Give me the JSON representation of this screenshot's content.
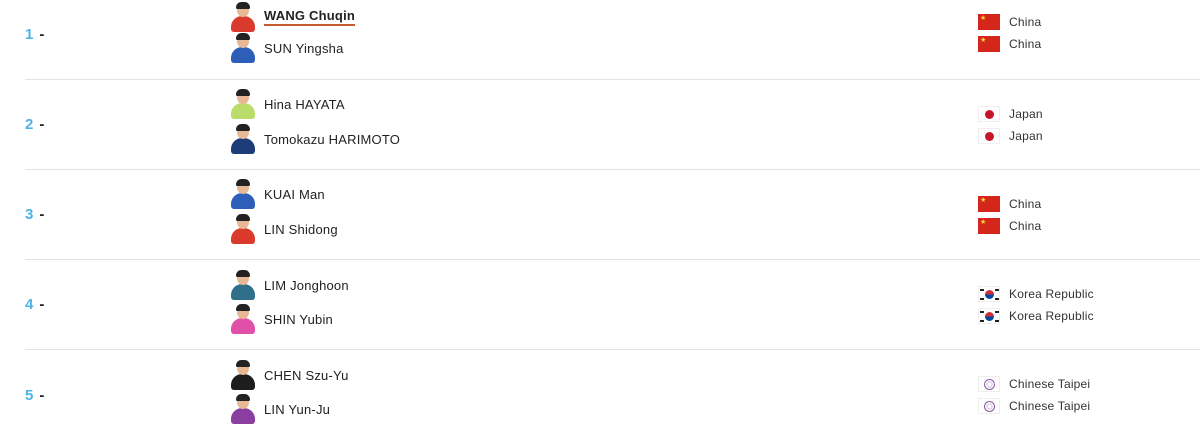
{
  "rankings": [
    {
      "rank": "1",
      "dash": "-",
      "players": [
        {
          "name": "WANG Chuqin",
          "highlight": true,
          "shirt": "red"
        },
        {
          "name": "SUN Yingsha",
          "highlight": false,
          "shirt": "blue"
        }
      ],
      "countries": [
        {
          "name": "China",
          "flag": "china-flag-icon"
        },
        {
          "name": "China",
          "flag": "china-flag-icon"
        }
      ]
    },
    {
      "rank": "2",
      "dash": "-",
      "players": [
        {
          "name": "Hina HAYATA",
          "highlight": false,
          "shirt": "green"
        },
        {
          "name": "Tomokazu HARIMOTO",
          "highlight": false,
          "shirt": "navy"
        }
      ],
      "countries": [
        {
          "name": "Japan",
          "flag": "japan-flag-icon"
        },
        {
          "name": "Japan",
          "flag": "japan-flag-icon"
        }
      ]
    },
    {
      "rank": "3",
      "dash": "-",
      "players": [
        {
          "name": "KUAI Man",
          "highlight": false,
          "shirt": "blue"
        },
        {
          "name": "LIN Shidong",
          "highlight": false,
          "shirt": "red"
        }
      ],
      "countries": [
        {
          "name": "China",
          "flag": "china-flag-icon"
        },
        {
          "name": "China",
          "flag": "china-flag-icon"
        }
      ]
    },
    {
      "rank": "4",
      "dash": "-",
      "players": [
        {
          "name": "LIM Jonghoon",
          "highlight": false,
          "shirt": "teal"
        },
        {
          "name": "SHIN Yubin",
          "highlight": false,
          "shirt": "pink"
        }
      ],
      "countries": [
        {
          "name": "Korea Republic",
          "flag": "korea-flag-icon"
        },
        {
          "name": "Korea Republic",
          "flag": "korea-flag-icon"
        }
      ]
    },
    {
      "rank": "5",
      "dash": "-",
      "players": [
        {
          "name": "CHEN Szu-Yu",
          "highlight": false,
          "shirt": "black"
        },
        {
          "name": "LIN Yun-Ju",
          "highlight": false,
          "shirt": "purple"
        }
      ],
      "countries": [
        {
          "name": "Chinese Taipei",
          "flag": "chinese-taipei-flag-icon"
        },
        {
          "name": "Chinese Taipei",
          "flag": "chinese-taipei-flag-icon"
        }
      ]
    }
  ],
  "colors": {
    "rank_accent": "#4fb3e6",
    "highlight_underline": "#c65a2a"
  }
}
